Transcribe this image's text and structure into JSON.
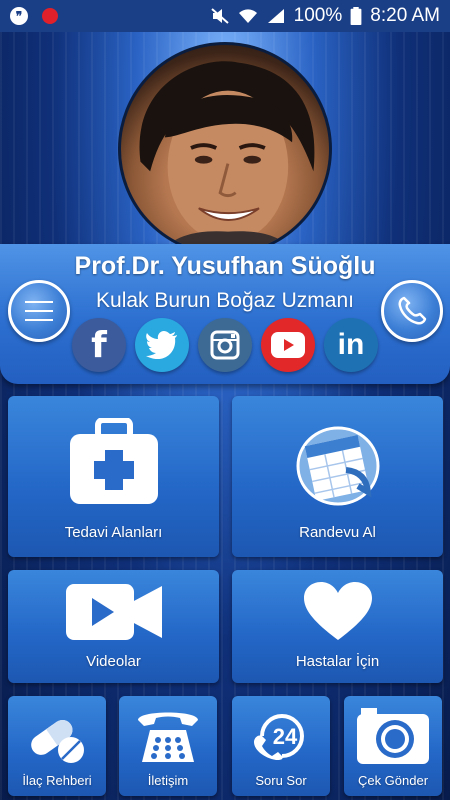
{
  "status_bar": {
    "battery": "100%",
    "time": "8:20 AM"
  },
  "profile": {
    "name": "Prof.Dr. Yusufhan Süoğlu",
    "title": "Kulak Burun Boğaz Uzmanı"
  },
  "header_buttons": {
    "menu_icon": "hamburger-menu-icon",
    "phone_icon": "phone-icon"
  },
  "socials": [
    {
      "name": "facebook",
      "icon": "facebook-icon",
      "glyph": "f",
      "color": "#3b5b9c"
    },
    {
      "name": "twitter",
      "icon": "twitter-icon",
      "color": "#2aa8e0"
    },
    {
      "name": "instagram",
      "icon": "instagram-icon",
      "color": "#3d6a95"
    },
    {
      "name": "youtube",
      "icon": "youtube-icon",
      "color": "#e3282a"
    },
    {
      "name": "linkedin",
      "icon": "linkedin-icon",
      "glyph": "in",
      "color": "#1e72b3"
    }
  ],
  "tiles": {
    "treatment": {
      "label": "Tedavi Alanları",
      "icon": "medical-kit-icon"
    },
    "appointment": {
      "label": "Randevu Al",
      "icon": "calendar-icon"
    },
    "videos": {
      "label": "Videolar",
      "icon": "video-camera-icon"
    },
    "patients": {
      "label": "Hastalar İçin",
      "icon": "heart-icon"
    },
    "medicine": {
      "label": "İlaç Rehberi",
      "icon": "pills-icon"
    },
    "contact": {
      "label": "İletişim",
      "icon": "telephone-icon"
    },
    "ask": {
      "label": "Soru Sor",
      "icon": "24h-support-icon",
      "badge": "24"
    },
    "send_photo": {
      "label": "Çek Gönder",
      "icon": "camera-icon"
    }
  },
  "colors": {
    "accent": "#2c6fd0",
    "statusbar": "#1b3f86",
    "background": "#0f2f78"
  }
}
